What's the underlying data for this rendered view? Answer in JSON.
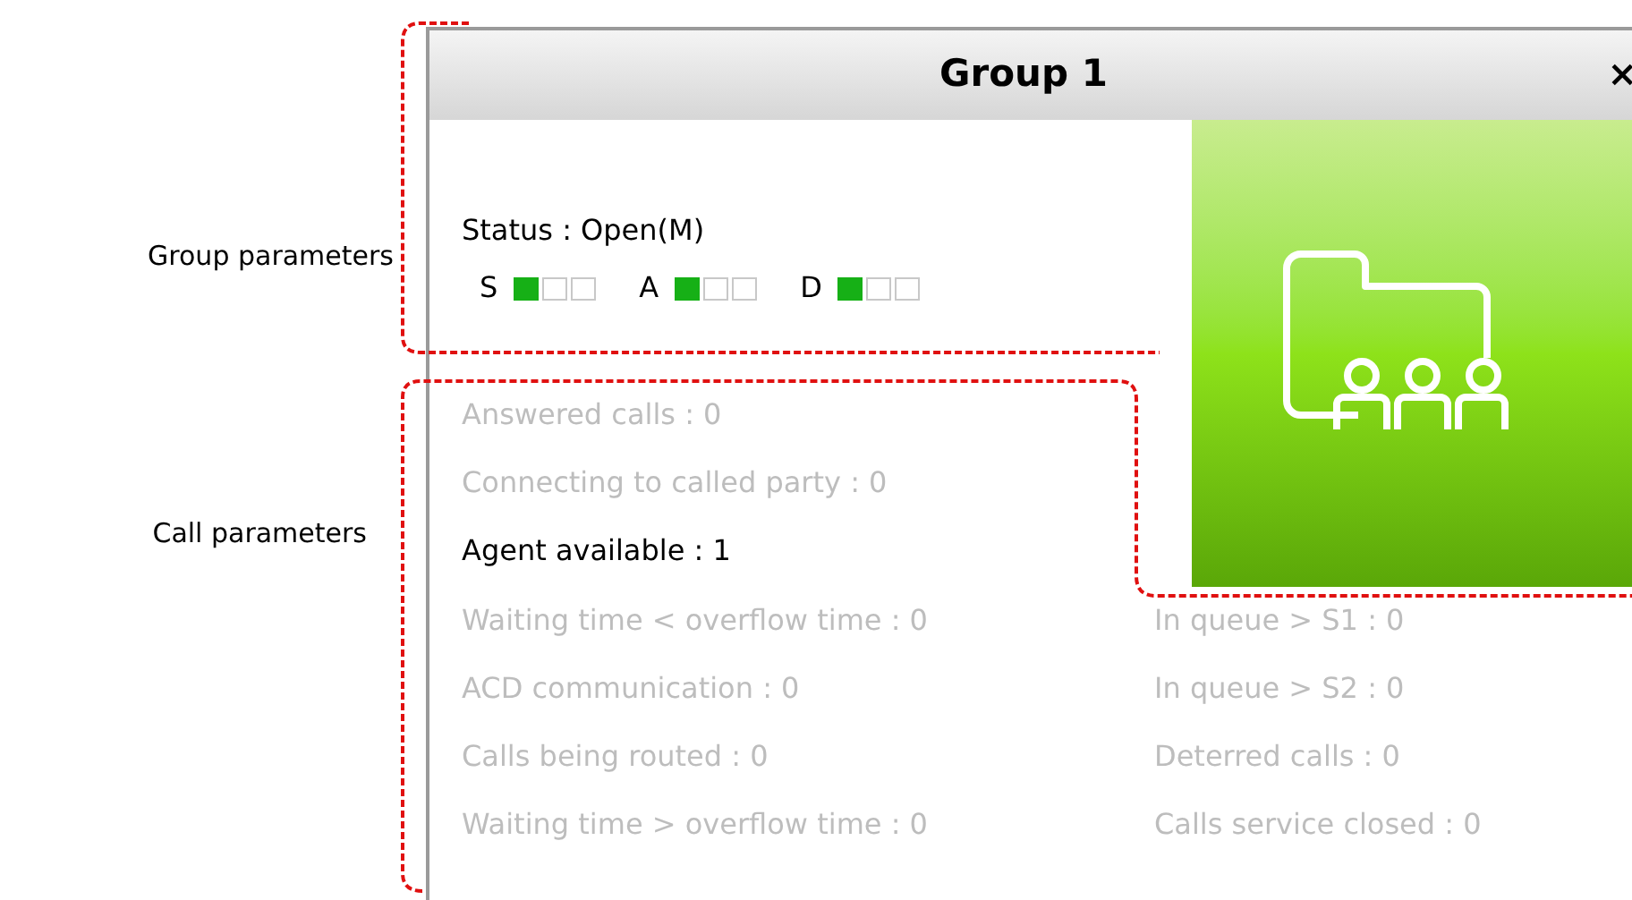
{
  "annotations": [
    {
      "label": "Group parameters"
    },
    {
      "label": "Call parameters"
    }
  ],
  "window": {
    "title": "Group 1",
    "close": "×"
  },
  "status": "Status : Open(M)",
  "indicators": [
    {
      "letter": "S",
      "boxes": [
        {
          "filled": true
        },
        {
          "filled": false
        },
        {
          "filled": false
        }
      ]
    },
    {
      "letter": "A",
      "boxes": [
        {
          "filled": true
        },
        {
          "filled": false
        },
        {
          "filled": false
        }
      ]
    },
    {
      "letter": "D",
      "boxes": [
        {
          "filled": true
        },
        {
          "filled": false
        },
        {
          "filled": false
        }
      ]
    }
  ],
  "left_column": [
    {
      "text": "Answered calls : 0",
      "active": false
    },
    {
      "text": "Connecting to called party : 0",
      "active": false
    },
    {
      "text": "Agent available : 1",
      "active": true
    },
    {
      "text": "Waiting time < overflow time : 0",
      "active": false
    },
    {
      "text": "ACD communication : 0",
      "active": false
    },
    {
      "text": "Calls being routed : 0",
      "active": false
    },
    {
      "text": "Waiting time > overflow time : 0",
      "active": false
    }
  ],
  "right_column": [
    {
      "text": "In queue > S1 : 0",
      "active": false
    },
    {
      "text": "In queue > S2 : 0",
      "active": false
    },
    {
      "text": "Deterred calls : 0",
      "active": false
    },
    {
      "text": "Calls service closed : 0",
      "active": false
    }
  ]
}
